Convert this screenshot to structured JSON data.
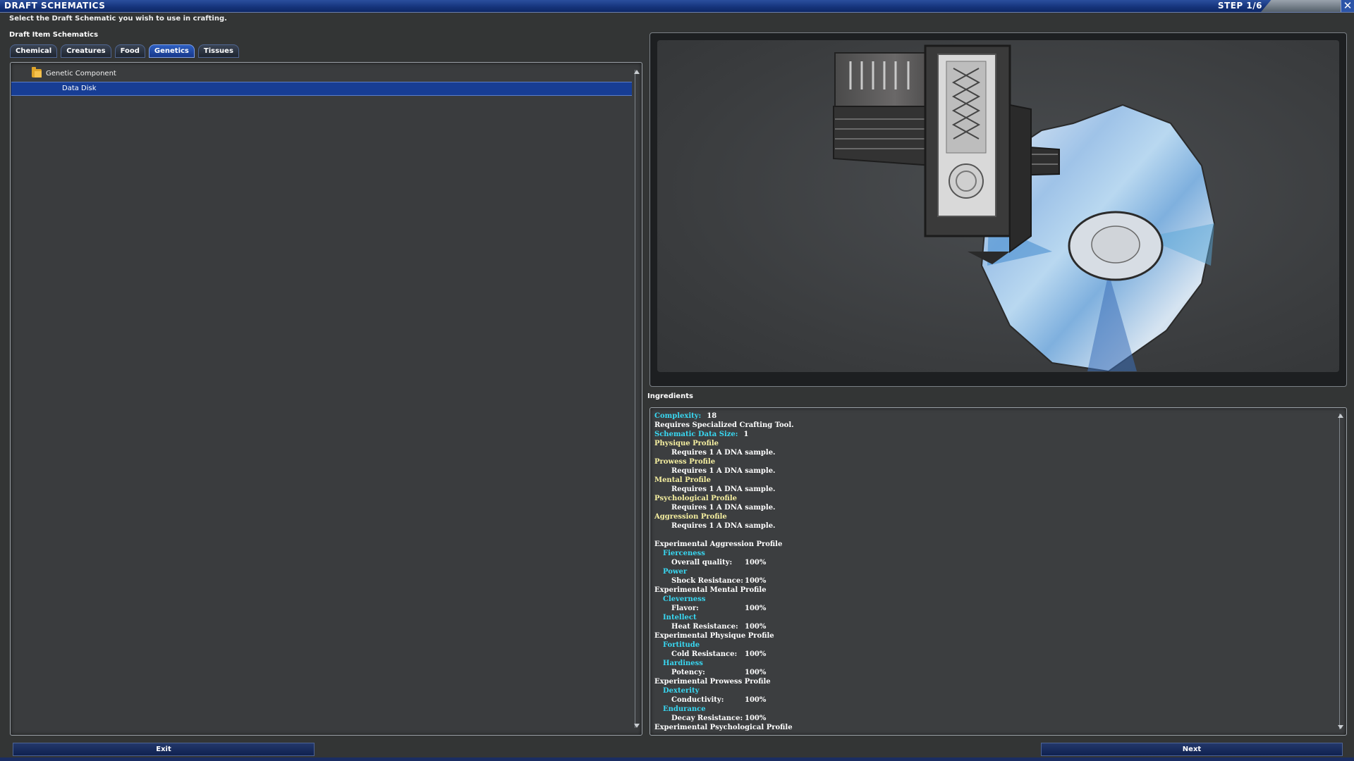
{
  "window": {
    "title": "DRAFT SCHEMATICS",
    "step": "STEP 1/6",
    "close": "✕",
    "instruction": "Select the Draft Schematic you wish to use in crafting."
  },
  "left": {
    "heading": "Draft Item Schematics",
    "tabs": [
      {
        "label": "Chemical",
        "active": false
      },
      {
        "label": "Creatures",
        "active": false
      },
      {
        "label": "Food",
        "active": false
      },
      {
        "label": "Genetics",
        "active": true
      },
      {
        "label": "Tissues",
        "active": false
      }
    ],
    "tree": {
      "group": "Genetic Component",
      "selected_item": "Data Disk"
    }
  },
  "ingredients": {
    "heading": "Ingredients",
    "lines": [
      {
        "label": "Complexity:",
        "value": "18",
        "style": "kv-cyan"
      },
      {
        "text": "Requires Specialized Crafting Tool.",
        "style": "white"
      },
      {
        "label": "Schematic Data Size:",
        "value": "1",
        "style": "kv-cyan"
      },
      {
        "text": "Physique Profile",
        "style": "yellow"
      },
      {
        "text": "Requires 1 A DNA sample.",
        "style": "white-ind2"
      },
      {
        "text": "Prowess Profile",
        "style": "yellow"
      },
      {
        "text": "Requires 1 A DNA sample.",
        "style": "white-ind2"
      },
      {
        "text": "Mental Profile",
        "style": "yellow"
      },
      {
        "text": "Requires 1 A DNA sample.",
        "style": "white-ind2"
      },
      {
        "text": "Psychological Profile",
        "style": "yellow"
      },
      {
        "text": "Requires 1 A DNA sample.",
        "style": "white-ind2"
      },
      {
        "text": "Aggression Profile",
        "style": "yellow"
      },
      {
        "text": "Requires 1 A DNA sample.",
        "style": "white-ind2"
      },
      {
        "text": "",
        "style": "blank"
      },
      {
        "text": "Experimental Aggression Profile",
        "style": "white"
      },
      {
        "text": "Fierceness",
        "style": "cyan-ind1"
      },
      {
        "label": "Overall quality:",
        "value": "100%",
        "style": "kv-ind2"
      },
      {
        "text": "Power",
        "style": "cyan-ind1"
      },
      {
        "label": "Shock Resistance:",
        "value": "100%",
        "style": "kv-ind2"
      },
      {
        "text": "Experimental Mental Profile",
        "style": "white"
      },
      {
        "text": "Cleverness",
        "style": "cyan-ind1"
      },
      {
        "label": "Flavor:",
        "value": "100%",
        "style": "kv-ind2"
      },
      {
        "text": "Intellect",
        "style": "cyan-ind1"
      },
      {
        "label": "Heat Resistance:",
        "value": "100%",
        "style": "kv-ind2"
      },
      {
        "text": "Experimental Physique Profile",
        "style": "white"
      },
      {
        "text": "Fortitude",
        "style": "cyan-ind1"
      },
      {
        "label": "Cold Resistance:",
        "value": "100%",
        "style": "kv-ind2"
      },
      {
        "text": "Hardiness",
        "style": "cyan-ind1"
      },
      {
        "label": "Potency:",
        "value": "100%",
        "style": "kv-ind2"
      },
      {
        "text": "Experimental Prowess Profile",
        "style": "white"
      },
      {
        "text": "Dexterity",
        "style": "cyan-ind1"
      },
      {
        "label": "Conductivity:",
        "value": "100%",
        "style": "kv-ind2"
      },
      {
        "text": "Endurance",
        "style": "cyan-ind1"
      },
      {
        "label": "Decay Resistance:",
        "value": "100%",
        "style": "kv-ind2"
      },
      {
        "text": "Experimental Psychological Profile",
        "style": "white"
      }
    ]
  },
  "buttons": {
    "exit": "Exit",
    "next": "Next"
  },
  "colors": {
    "accent_blue": "#173d94",
    "label_cyan": "#38d8f2",
    "section_yellow": "#f5efa0",
    "folder_gold": "#e0a52a"
  }
}
